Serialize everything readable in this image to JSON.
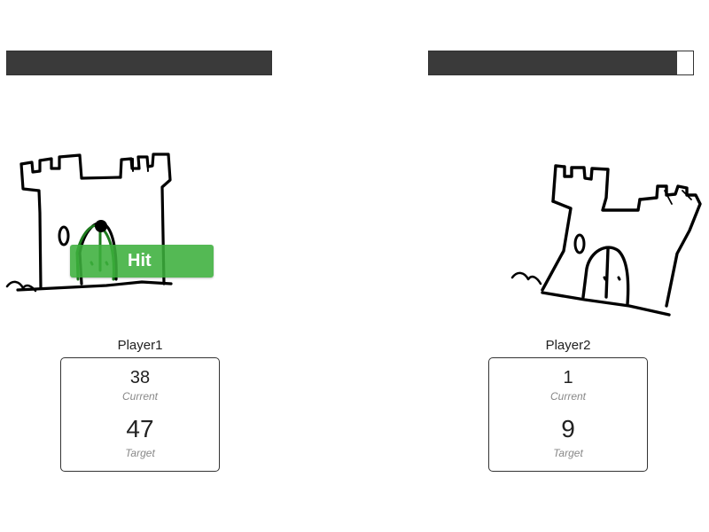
{
  "players": [
    {
      "name": "Player1",
      "health_fraction": 1.0,
      "current": "38",
      "current_label": "Current",
      "target": "47",
      "target_label": "Target"
    },
    {
      "name": "Player2",
      "health_fraction": 0.94,
      "current": "1",
      "current_label": "Current",
      "target": "9",
      "target_label": "Target"
    }
  ],
  "hit_button": {
    "label": "Hit",
    "color": "#3caf3c"
  },
  "colors": {
    "healthbar_fill": "#3a3a3a",
    "castle1_ink": "#000000",
    "castle1_overlay_ink": "#1e7a1e",
    "castle2_ink": "#000000"
  },
  "icons": {
    "castle1": "castle-sketch-icon",
    "castle2": "castle-sketch-icon"
  }
}
